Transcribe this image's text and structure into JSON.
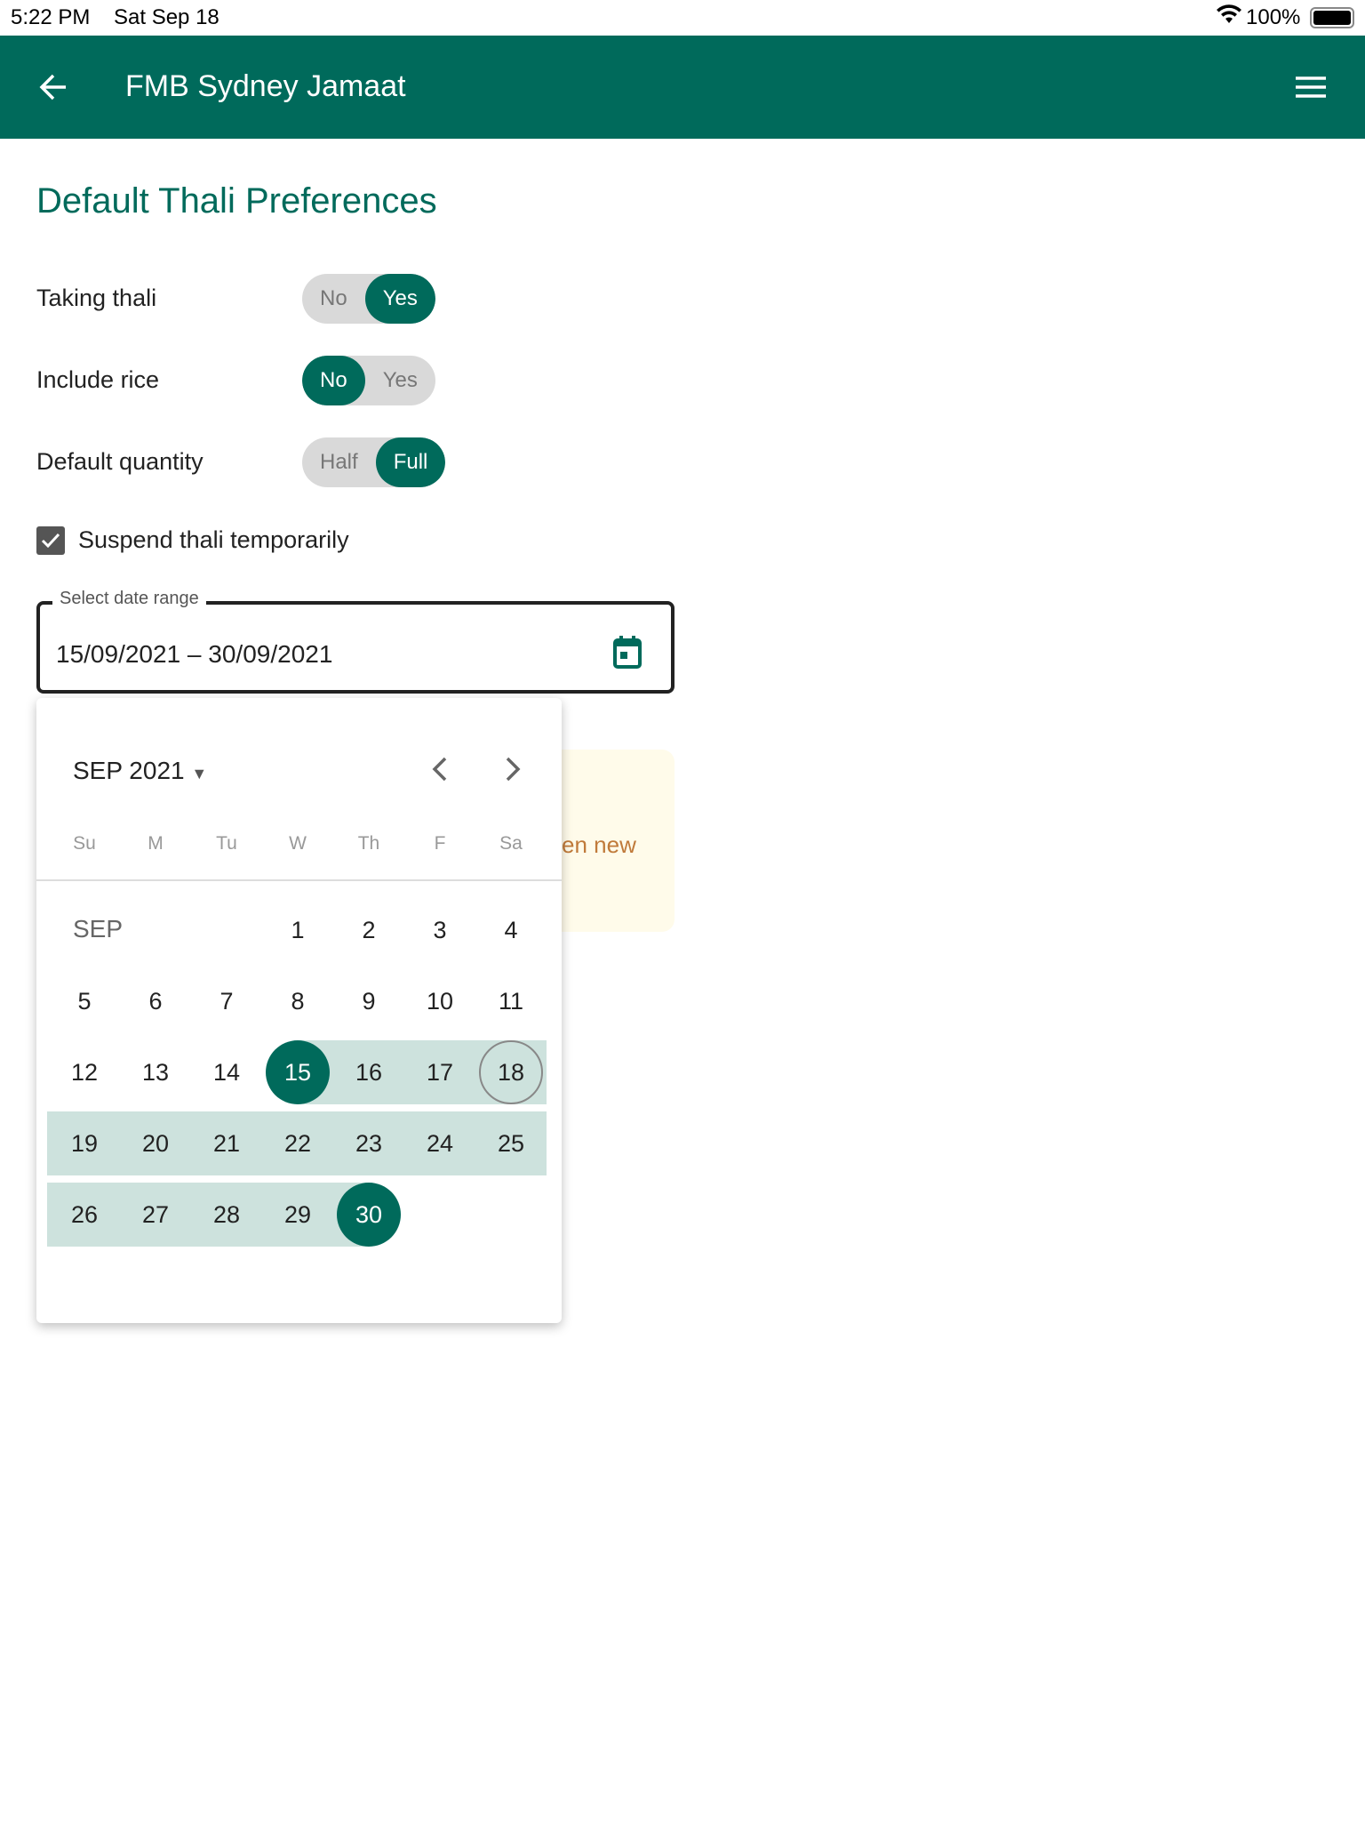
{
  "status_bar": {
    "time": "5:22 PM",
    "date": "Sat Sep 18",
    "battery": "100%"
  },
  "header": {
    "title": "FMB Sydney Jamaat",
    "back_icon": "arrow-left-icon",
    "menu_icon": "hamburger-menu-icon"
  },
  "colors": {
    "brand": "#006a5b",
    "range": "#cde2dd",
    "note_bg": "#fffbea",
    "note_text": "#c07a3a"
  },
  "page": {
    "title": "Default Thali Preferences",
    "prefs": [
      {
        "label": "Taking thali",
        "options": [
          "No",
          "Yes"
        ],
        "selected": "Yes"
      },
      {
        "label": "Include rice",
        "options": [
          "No",
          "Yes"
        ],
        "selected": "No"
      },
      {
        "label": "Default quantity",
        "options": [
          "Half",
          "Full"
        ],
        "selected": "Full"
      }
    ],
    "suspend": {
      "label": "Suspend thali temporarily",
      "checked": true
    },
    "date_range": {
      "label": "Select date range",
      "value": "15/09/2021 – 30/09/2021"
    },
    "note_partial": "en new"
  },
  "calendar": {
    "month_label": "SEP 2021",
    "weekdays": [
      "Su",
      "M",
      "Tu",
      "W",
      "Th",
      "F",
      "Sa"
    ],
    "row_label": "SEP",
    "first_weekday": 3,
    "days_in_month": 30,
    "range_start": 15,
    "range_end": 30,
    "today": 18
  }
}
